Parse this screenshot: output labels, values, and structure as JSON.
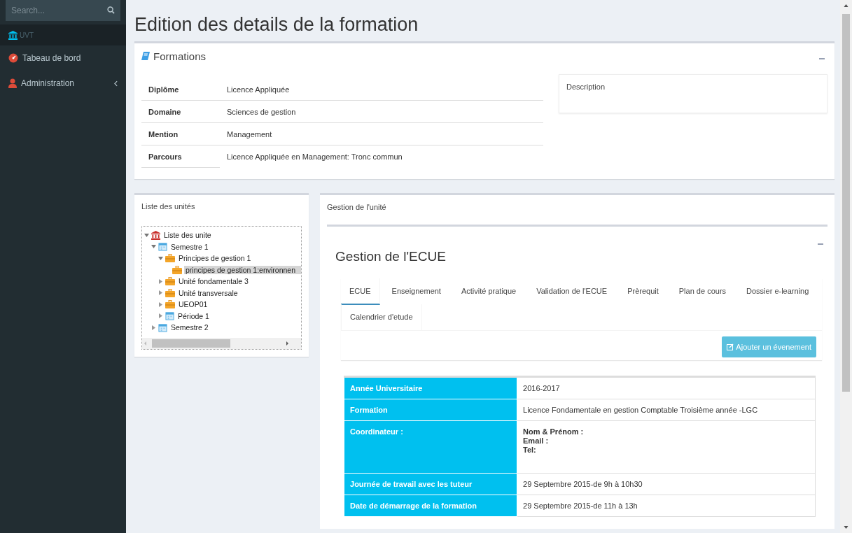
{
  "sidebar": {
    "search": {
      "placeholder": "Search..."
    },
    "brand": "UVT",
    "items": [
      {
        "label": "Tabeau de bord",
        "kind": "link"
      },
      {
        "label": "Administration",
        "kind": "submenu"
      }
    ]
  },
  "page_title": "Edition des details de la formation",
  "formations": {
    "title": "Formations",
    "fields": [
      {
        "label": "Diplôme",
        "value": "Licence Appliquée"
      },
      {
        "label": "Domaine",
        "value": "Sciences de gestion"
      },
      {
        "label": "Mention",
        "value": "Management"
      },
      {
        "label": "Parcours",
        "value": "Licence Appliquée en Management: Tronc commun"
      }
    ],
    "description_label": "Description"
  },
  "units_panel": {
    "title": "Liste des unités",
    "tree": [
      {
        "label": "Liste des unite",
        "kind": "root",
        "expanded": true,
        "selected": false,
        "children": [
          {
            "label": "Semestre 1",
            "kind": "period",
            "expanded": true,
            "selected": false,
            "children": [
              {
                "label": "Principes de gestion 1",
                "kind": "unit",
                "expanded": true,
                "selected": false,
                "children": [
                  {
                    "label": "principes de gestion 1:environnen",
                    "kind": "unit",
                    "selected": true
                  }
                ]
              },
              {
                "label": "Unité fondamentale 3",
                "kind": "unit",
                "expanded": false,
                "selected": false
              },
              {
                "label": "Unité transversale",
                "kind": "unit",
                "expanded": false,
                "selected": false
              },
              {
                "label": "UEOP01",
                "kind": "unit",
                "expanded": false,
                "selected": false
              },
              {
                "label": "Période 1",
                "kind": "period",
                "expanded": false,
                "selected": false
              }
            ]
          },
          {
            "label": "Semestre 2",
            "kind": "period",
            "expanded": false,
            "selected": false
          }
        ]
      }
    ]
  },
  "unit_panel": {
    "title": "Gestion de l'unité",
    "ecue": {
      "title": "Gestion de l'ECUE",
      "tabs": [
        {
          "label": "ECUE",
          "selected": true
        },
        {
          "label": "Enseignement",
          "selected": false
        },
        {
          "label": "Activité pratique",
          "selected": false
        },
        {
          "label": "Validation de l'ECUE",
          "selected": false
        },
        {
          "label": "Prèrequit",
          "selected": false
        },
        {
          "label": "Plan de cours",
          "selected": false
        },
        {
          "label": "Dossier e-learning",
          "selected": false
        },
        {
          "label": "Calendrier d'etude",
          "selected": false
        }
      ],
      "add_button": "Ajouter un évenement",
      "table": [
        {
          "kind": "text",
          "label": "Année Universitaire",
          "value": "2016-2017"
        },
        {
          "kind": "text",
          "label": "Formation",
          "value": "Licence Fondamentale en gestion Comptable Troisième année -LGC"
        },
        {
          "kind": "contact",
          "label": "Coordinateur :",
          "lines": [
            "Nom & Prénom :",
            "Email :",
            "Tel:"
          ]
        },
        {
          "kind": "text",
          "label": "Journée de travail avec les tuteur",
          "value": "29 Septembre 2015-de 9h à 10h30"
        },
        {
          "kind": "text",
          "label": "Date de démarrage de la formation",
          "value": "29 Septembre 2015-de 11h à 13h"
        }
      ]
    }
  }
}
